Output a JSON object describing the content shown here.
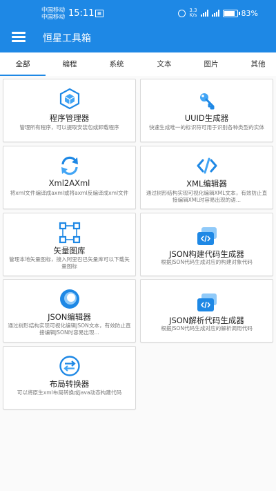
{
  "status_bar": {
    "carrier1": "中国移动",
    "carrier2": "中国移动",
    "time": "15:11",
    "net_speed_top": "3.3",
    "net_speed_bottom": "K/s",
    "battery": "83%"
  },
  "toolbar": {
    "title": "恒星工具箱",
    "menu_icon": "hamburger-menu-icon"
  },
  "tabs": [
    {
      "label": "全部",
      "active": true
    },
    {
      "label": "编程"
    },
    {
      "label": "系统"
    },
    {
      "label": "文本"
    },
    {
      "label": "图片"
    },
    {
      "label": "其他"
    }
  ],
  "colors": {
    "primary": "#1e88e5",
    "accent_light": "#42a5f5"
  },
  "tools": [
    {
      "title": "程序管理器",
      "desc": "管理所有程序，可以提取安装包或卸载程序",
      "icon": "cube-package-icon"
    },
    {
      "title": "UUID生成器",
      "desc": "快速生成唯一的标识符可用于识别各种类型的实体",
      "icon": "key-icon"
    },
    {
      "title": "Xml2AXml",
      "desc": "将xml文件编译成axml或将axml反编译成xml文件",
      "icon": "sync-icon"
    },
    {
      "title": "XML编辑器",
      "desc": "通过树形结构实现可视化编辑XML文本，有效防止直接编辑XML时容易出现的语...",
      "icon": "code-brackets-icon"
    },
    {
      "title": "矢量图库",
      "desc": "管理本地矢量图标，接入阿里巴巴矢量库可以下载矢量图标",
      "icon": "vector-nodes-icon"
    },
    {
      "title": "JSON构建代码生成器",
      "desc": "根据JSON代码生成对应的构建对象代码",
      "icon": "code-window-icon"
    },
    {
      "title": "JSON编辑器",
      "desc": "通过树形结构实现可视化编辑JSON文本，有效防止直接编辑JSON时容易出现...",
      "icon": "json-swirl-icon"
    },
    {
      "title": "JSON解析代码生成器",
      "desc": "根据JSON代码生成对应的解析调用代码",
      "icon": "code-window-icon"
    },
    {
      "title": "布局转换器",
      "desc": "可以将原生xml布局转换成java动态构建代码",
      "icon": "swap-arrows-icon"
    }
  ]
}
